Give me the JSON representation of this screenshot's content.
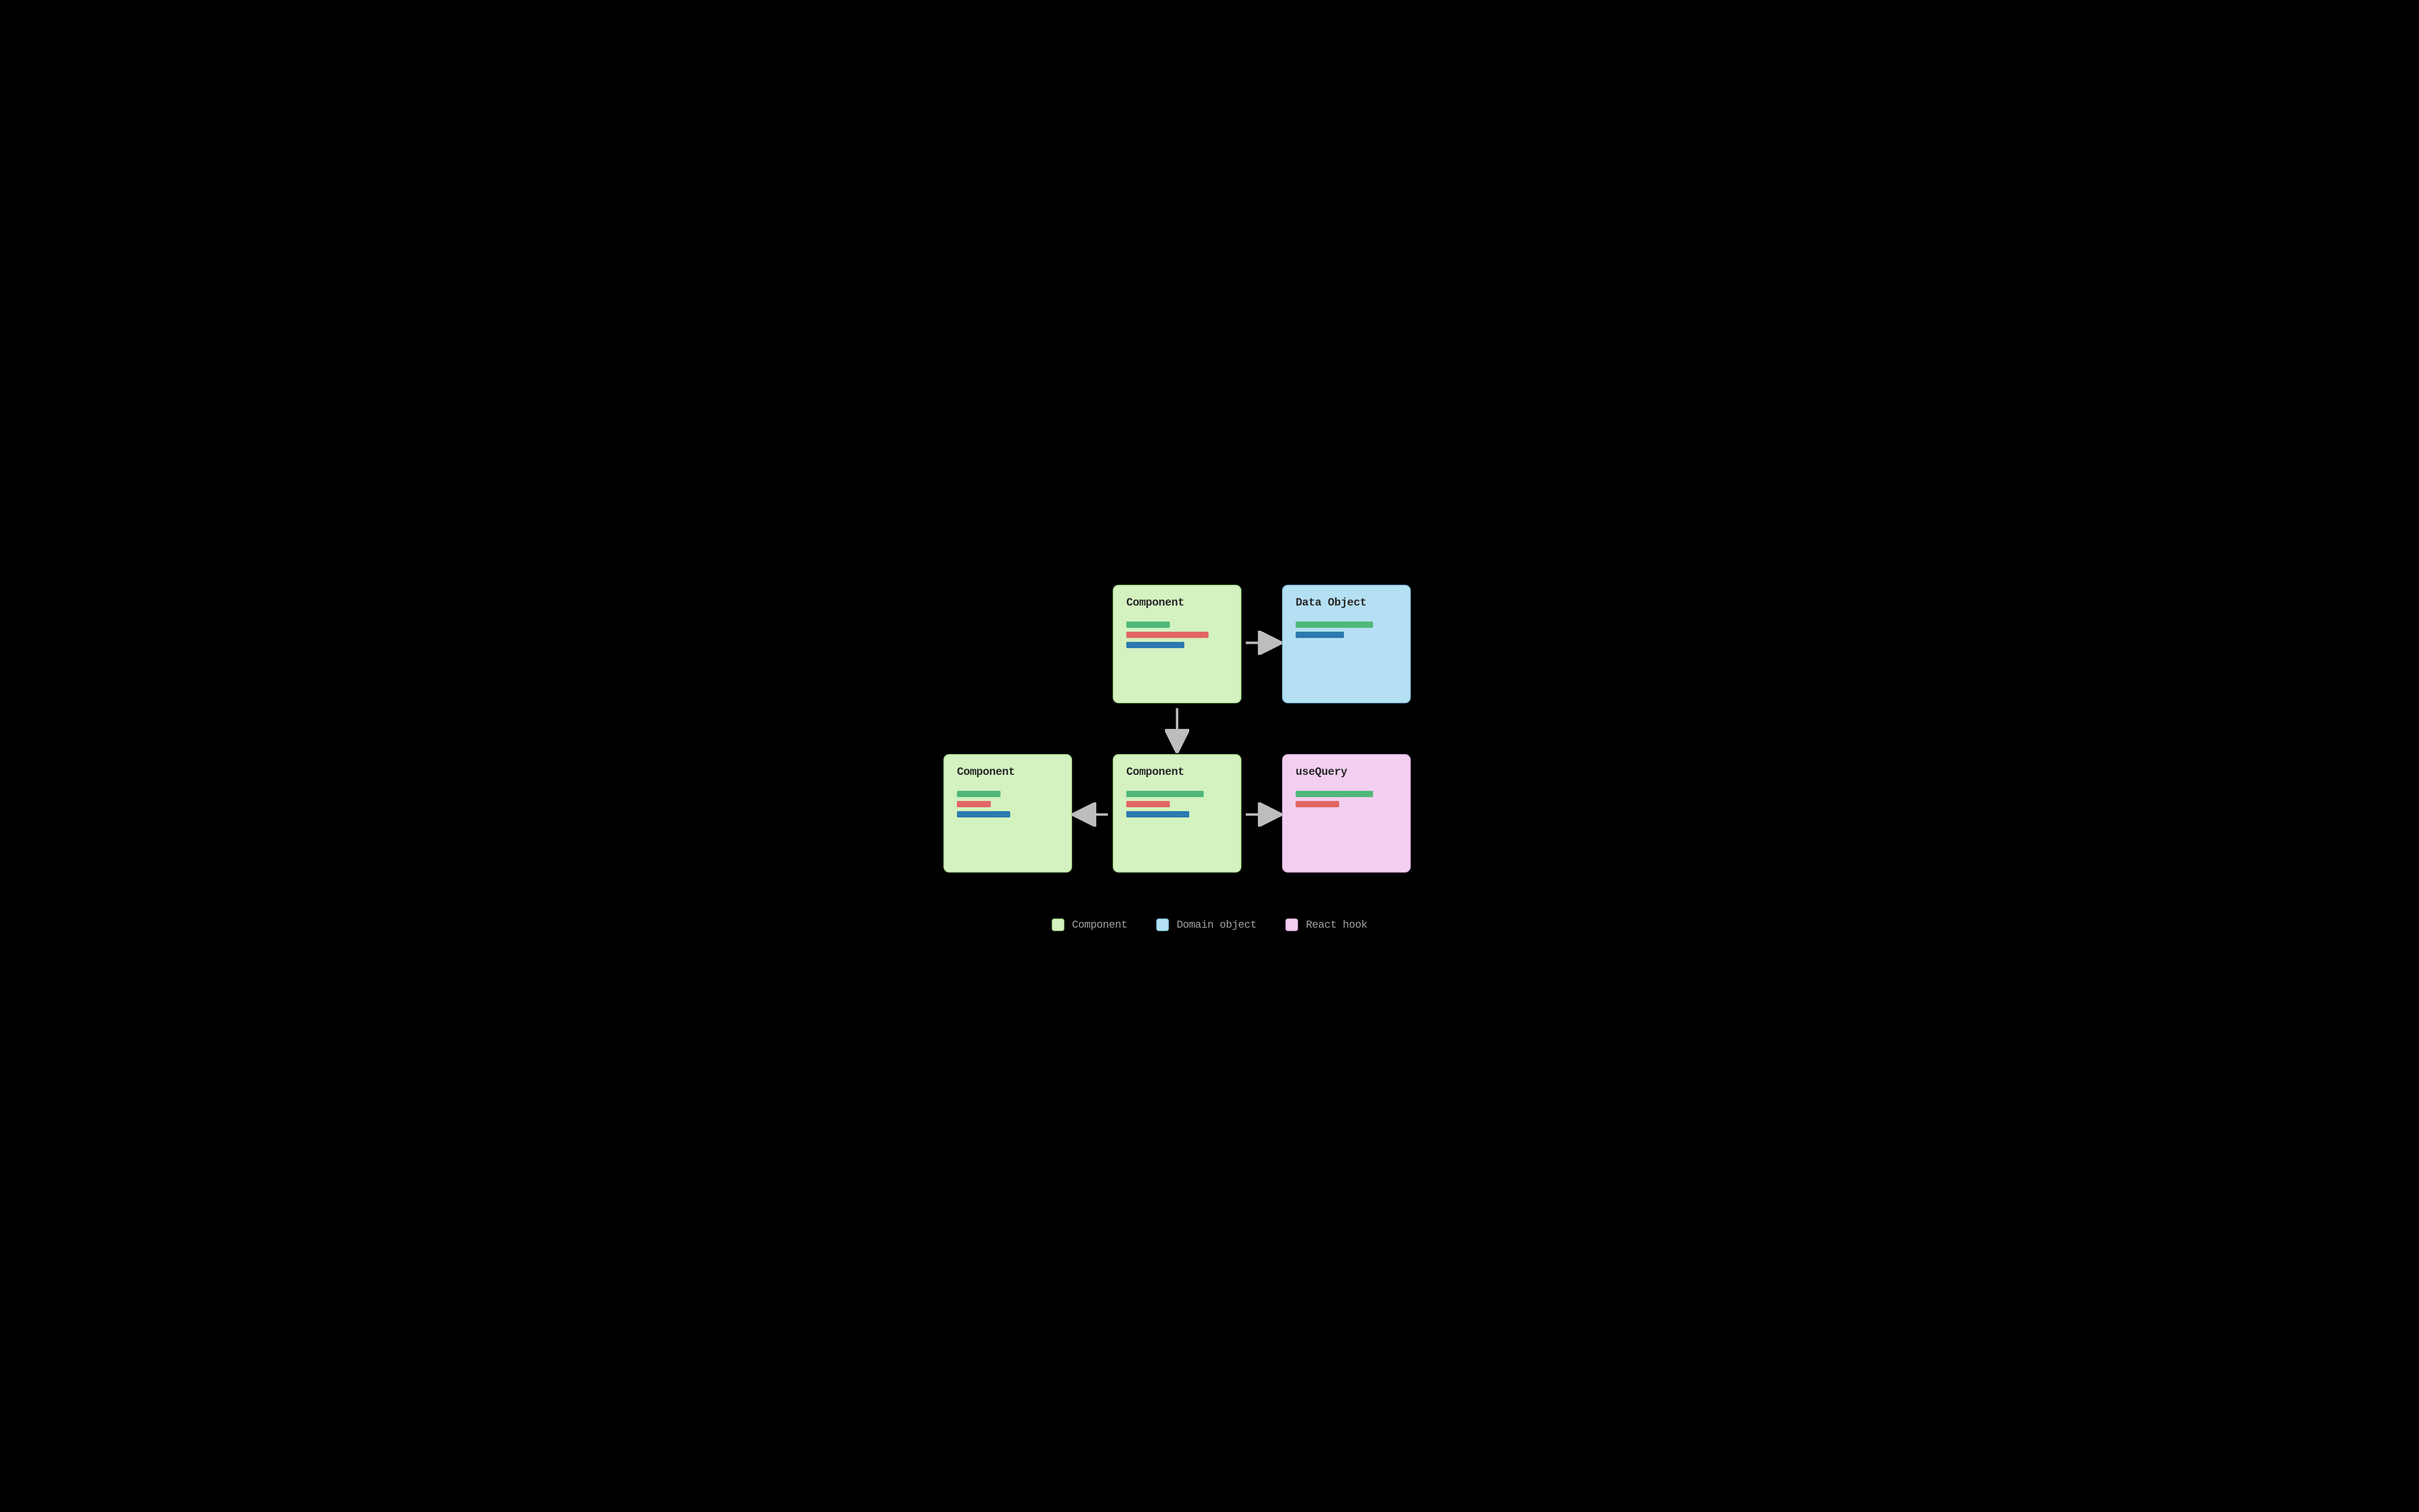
{
  "boxes": {
    "top_component": {
      "title": "Component",
      "bars": [
        {
          "color": "green",
          "width": 90
        },
        {
          "color": "red",
          "width": 170
        },
        {
          "color": "blue",
          "width": 120
        }
      ]
    },
    "data_object": {
      "title": "Data Object",
      "bars": [
        {
          "color": "green",
          "width": 160
        },
        {
          "color": "blue",
          "width": 100
        }
      ]
    },
    "left_component": {
      "title": "Component",
      "bars": [
        {
          "color": "green",
          "width": 90
        },
        {
          "color": "red",
          "width": 70
        },
        {
          "color": "blue",
          "width": 110
        }
      ]
    },
    "center_component": {
      "title": "Component",
      "bars": [
        {
          "color": "green",
          "width": 160
        },
        {
          "color": "red",
          "width": 90
        },
        {
          "color": "blue",
          "width": 130
        }
      ]
    },
    "use_query": {
      "title": "useQuery",
      "bars": [
        {
          "color": "green",
          "width": 160
        },
        {
          "color": "red",
          "width": 90
        }
      ]
    }
  },
  "legend": {
    "items": [
      {
        "label": "Component",
        "color": "green"
      },
      {
        "label": "Domain object",
        "color": "blue"
      },
      {
        "label": "React hook",
        "color": "pink"
      }
    ]
  },
  "colors": {
    "card_green_bg": "#d4f1c0",
    "card_blue_bg": "#b5e0f3",
    "card_pink_bg": "#f2cff0",
    "bar_green": "#4fb87a",
    "bar_red": "#e26664",
    "bar_blue": "#2b7ab0",
    "arrow": "#bdbdbd"
  }
}
